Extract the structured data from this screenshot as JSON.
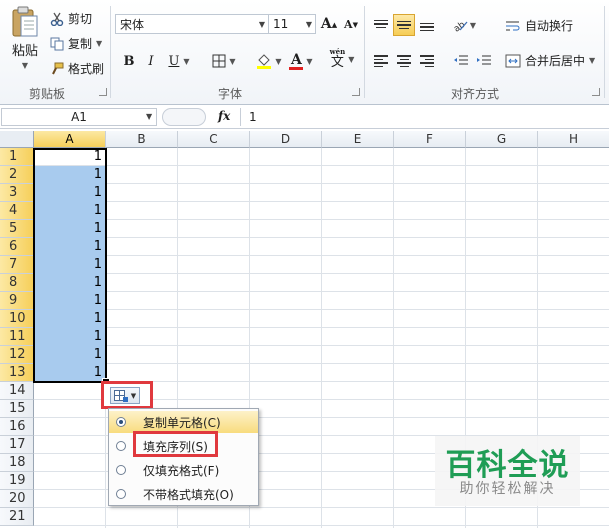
{
  "ribbon": {
    "clipboard": {
      "paste_label": "粘贴",
      "cut_label": "剪切",
      "copy_label": "复制",
      "format_painter_label": "格式刷",
      "group_label": "剪贴板"
    },
    "font": {
      "font_name": "宋体",
      "font_size": "11",
      "grow_label": "A",
      "shrink_label": "A",
      "bold": "B",
      "italic": "I",
      "underline": "U",
      "font_color_letter": "A",
      "phonetic_top": "wén",
      "phonetic_char": "文",
      "group_label": "字体"
    },
    "alignment": {
      "wrap_text_label": "自动换行",
      "merge_center_label": "合并后居中",
      "group_label": "对齐方式"
    }
  },
  "formula_bar": {
    "name_box": "A1",
    "fx_label": "fx",
    "value": "1"
  },
  "grid": {
    "columns": [
      "A",
      "B",
      "C",
      "D",
      "E",
      "F",
      "G",
      "H"
    ],
    "rows": [
      "1",
      "2",
      "3",
      "4",
      "5",
      "6",
      "7",
      "8",
      "9",
      "10",
      "11",
      "12",
      "13",
      "14",
      "15",
      "16",
      "17",
      "18",
      "19",
      "20",
      "21"
    ],
    "col_a_values": [
      "1",
      "1",
      "1",
      "1",
      "1",
      "1",
      "1",
      "1",
      "1",
      "1",
      "1",
      "1",
      "1"
    ]
  },
  "autofill_menu": {
    "items": [
      {
        "label": "复制单元格(C)",
        "checked": true
      },
      {
        "label": "填充序列(S)",
        "checked": false
      },
      {
        "label": "仅填充格式(F)",
        "checked": false
      },
      {
        "label": "不带格式填充(O)",
        "checked": false
      }
    ]
  },
  "watermark": {
    "title": "百科全说",
    "subtitle": "助你轻松解决"
  },
  "colors": {
    "selection": "#a8cbee",
    "highlight_red": "#e0393e",
    "watermark_green": "#1f9d55"
  }
}
